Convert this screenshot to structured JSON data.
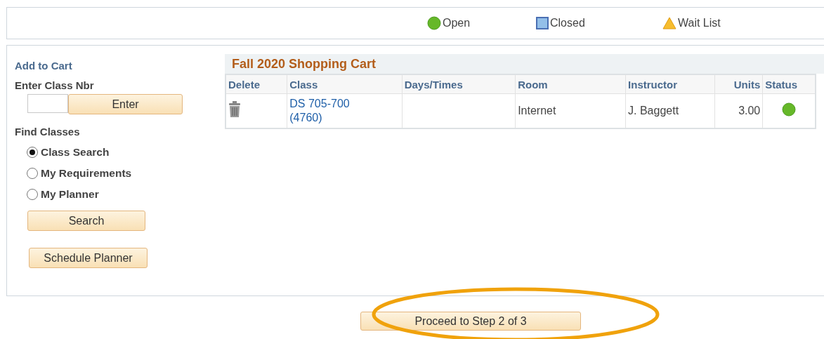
{
  "legend": [
    {
      "kind": "open",
      "label": "Open"
    },
    {
      "kind": "closed",
      "label": "Closed"
    },
    {
      "kind": "waitlist",
      "label": "Wait List"
    }
  ],
  "add_to_cart": {
    "title": "Add to Cart",
    "class_nbr_label": "Enter Class Nbr",
    "enter_button": "Enter",
    "find_label": "Find Classes",
    "options": [
      {
        "label": "Class Search",
        "selected": true
      },
      {
        "label": "My Requirements",
        "selected": false
      },
      {
        "label": "My Planner",
        "selected": false
      }
    ],
    "search_button": "Search",
    "planner_button": "Schedule Planner"
  },
  "cart": {
    "title": "Fall 2020 Shopping Cart",
    "columns": [
      "Delete",
      "Class",
      "Days/Times",
      "Room",
      "Instructor",
      "Units",
      "Status"
    ],
    "rows": [
      {
        "class": "DS 705-700",
        "class_nbr": "(4760)",
        "room": "Internet",
        "instructor": "J. Baggett",
        "units": "3.00",
        "kind": "open"
      }
    ]
  },
  "proceed_button": "Proceed to Step 2 of 3"
}
